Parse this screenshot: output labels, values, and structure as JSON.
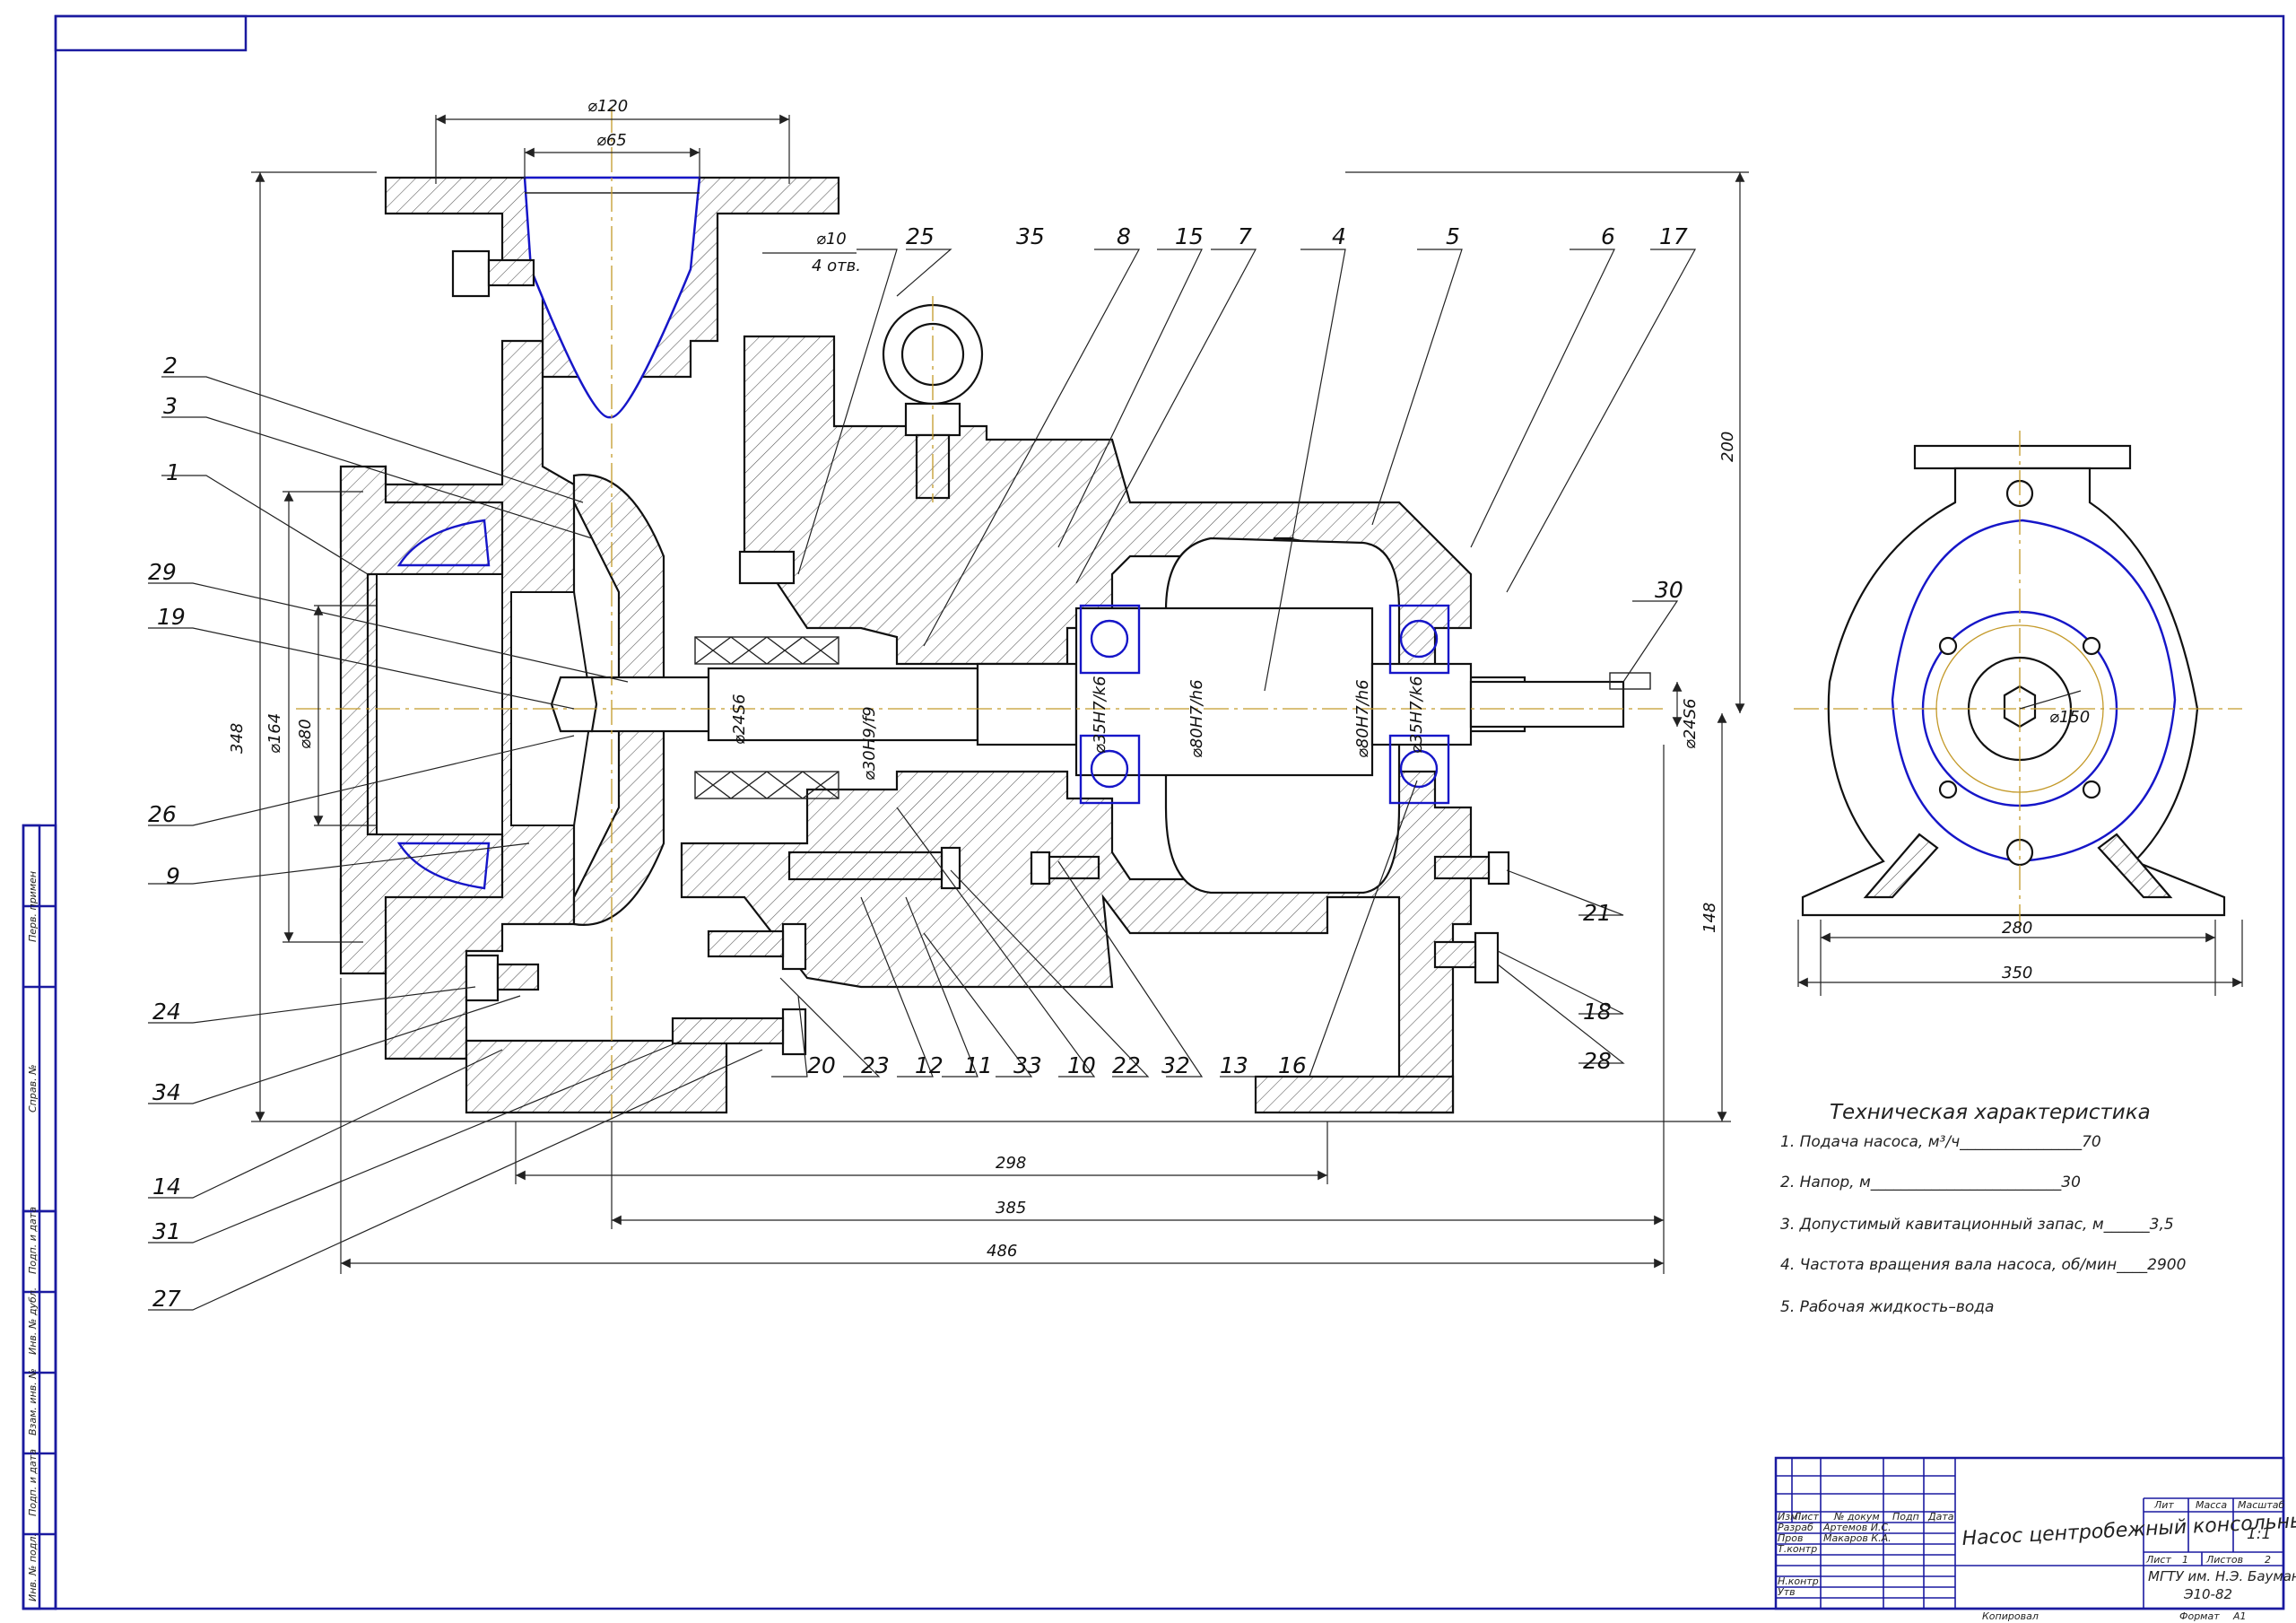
{
  "drawing_title": "Насос центробежный консольный",
  "callouts": [
    {
      "id": "25",
      "text": "25"
    },
    {
      "id": "35",
      "text": "35"
    },
    {
      "id": "8",
      "text": "8"
    },
    {
      "id": "15",
      "text": "15"
    },
    {
      "id": "7",
      "text": "7"
    },
    {
      "id": "4",
      "text": "4"
    },
    {
      "id": "5",
      "text": "5"
    },
    {
      "id": "6",
      "text": "6"
    },
    {
      "id": "17",
      "text": "17"
    },
    {
      "id": "2",
      "text": "2"
    },
    {
      "id": "3",
      "text": "3"
    },
    {
      "id": "1",
      "text": "1"
    },
    {
      "id": "29",
      "text": "29"
    },
    {
      "id": "19",
      "text": "19"
    },
    {
      "id": "26",
      "text": "26"
    },
    {
      "id": "9",
      "text": "9"
    },
    {
      "id": "24",
      "text": "24"
    },
    {
      "id": "34",
      "text": "34"
    },
    {
      "id": "14",
      "text": "14"
    },
    {
      "id": "31",
      "text": "31"
    },
    {
      "id": "27",
      "text": "27"
    },
    {
      "id": "20",
      "text": "20"
    },
    {
      "id": "23",
      "text": "23"
    },
    {
      "id": "12",
      "text": "12"
    },
    {
      "id": "11",
      "text": "11"
    },
    {
      "id": "33",
      "text": "33"
    },
    {
      "id": "10",
      "text": "10"
    },
    {
      "id": "22",
      "text": "22"
    },
    {
      "id": "32",
      "text": "32"
    },
    {
      "id": "13",
      "text": "13"
    },
    {
      "id": "16",
      "text": "16"
    },
    {
      "id": "30",
      "text": "30"
    },
    {
      "id": "21",
      "text": "21"
    },
    {
      "id": "18",
      "text": "18"
    },
    {
      "id": "28",
      "text": "28"
    }
  ],
  "dimensions": {
    "d120": "⌀120",
    "d65": "⌀65",
    "d10": "⌀10",
    "holes4": "4 отв.",
    "h348": "348",
    "d164": "⌀164",
    "d80": "⌀80",
    "d24s6a": "⌀24S6",
    "d30h9": "⌀30H9/f9",
    "d35h7a": "⌀35H7/k6",
    "d80h7a": "⌀80H7/h6",
    "d80h7b": "⌀80H7/h6",
    "d35h7b": "⌀35H7/k6",
    "d24s6b": "⌀24S6",
    "v200": "200",
    "v148": "148",
    "h298": "298",
    "h385": "385",
    "h486": "486",
    "d150": "⌀150",
    "w280": "280",
    "w350": "350"
  },
  "tech": {
    "title": "Техническая характеристика",
    "line1": "1. Подача насоса, м³/ч________________70",
    "line2": "2. Напор, м_________________________30",
    "line3": "3. Допустимый кавитационный запас, м______3,5",
    "line4": "4. Частота вращения вала насоса, об/мин____2900",
    "line5": "5. Рабочая жидкость–вода"
  },
  "titleblock": {
    "izm": "Изм",
    "list": "Лист",
    "ndoc": "№ докум",
    "podp": "Подп",
    "data": "Дата",
    "razrab": "Разраб",
    "razrab_name": "Артемов И.С.",
    "prov": "Пров",
    "prov_name": "Макаров К.А.",
    "tkontr": "Т.контр",
    "nkontr": "Н.контр",
    "utv": "Утв",
    "lit": "Лит",
    "massa": "Масса",
    "masshtab": "Масштаб",
    "scale": "1:1",
    "sheet": "Лист",
    "sheet_no": "1",
    "sheets": "Листов",
    "sheets_no": "2",
    "org1": "МГТУ им. Н.Э. Баумана",
    "org2": "Э10-82",
    "copied": "Копировал",
    "format": "Формат",
    "format_val": "А1"
  },
  "side_stamps": {
    "s1": "Перв. примен",
    "s2": "Справ. №",
    "s3": "Подп. и дата",
    "s4": "Инв. № дубл.",
    "s5": "Взам. инв. №",
    "s6": "Подп. и дата",
    "s7": "Инв. № подл."
  }
}
